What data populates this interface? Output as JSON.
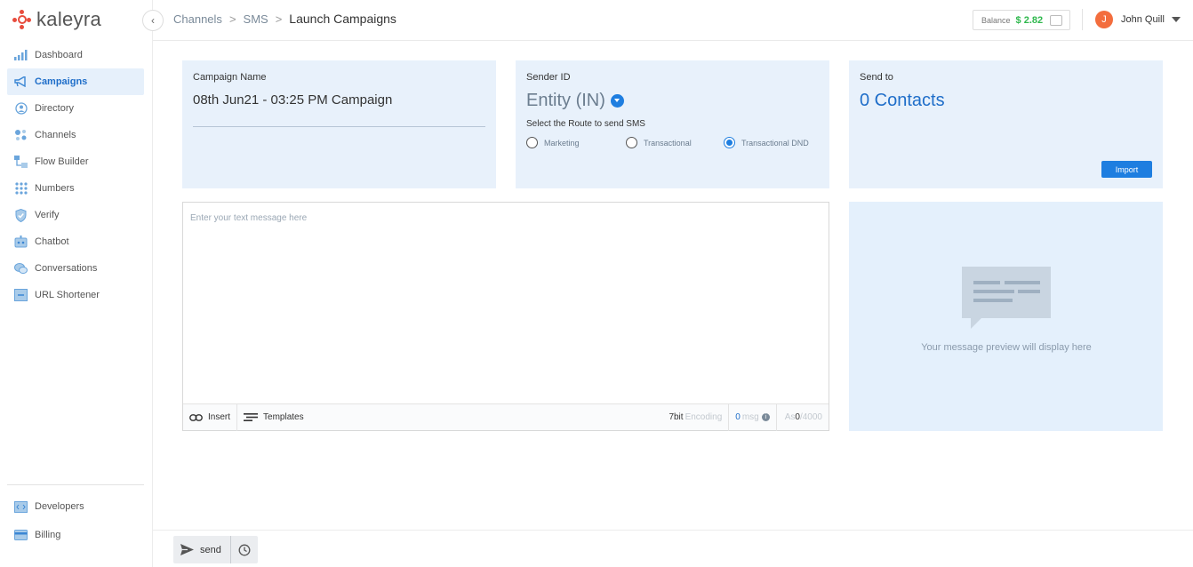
{
  "brand": {
    "name": "kaleyra",
    "color": "#e84c3d"
  },
  "sidebar": {
    "items": [
      {
        "label": "Dashboard",
        "icon": "bar-chart-icon",
        "active": false
      },
      {
        "label": "Campaigns",
        "icon": "megaphone-icon",
        "active": true
      },
      {
        "label": "Directory",
        "icon": "contact-circle-icon",
        "active": false
      },
      {
        "label": "Channels",
        "icon": "channels-icon",
        "active": false
      },
      {
        "label": "Flow Builder",
        "icon": "flow-icon",
        "active": false
      },
      {
        "label": "Numbers",
        "icon": "dial-pad-icon",
        "active": false
      },
      {
        "label": "Verify",
        "icon": "shield-check-icon",
        "active": false
      },
      {
        "label": "Chatbot",
        "icon": "robot-icon",
        "active": false
      },
      {
        "label": "Conversations",
        "icon": "chat-bubbles-icon",
        "active": false
      },
      {
        "label": "URL Shortener",
        "icon": "link-box-icon",
        "active": false
      }
    ],
    "bottom_items": [
      {
        "label": "Developers",
        "icon": "code-icon"
      },
      {
        "label": "Billing",
        "icon": "card-icon"
      }
    ]
  },
  "header": {
    "breadcrumb": [
      "Channels",
      "SMS",
      "Launch Campaigns"
    ],
    "balance_label": "Balance",
    "balance_amount": "$ 2.82",
    "user_initial": "J",
    "user_name": "John Quill"
  },
  "campaign": {
    "label": "Campaign Name",
    "value": "08th Jun21 - 03:25 PM Campaign"
  },
  "sender": {
    "label": "Sender ID",
    "value": "Entity (IN)",
    "route_label": "Select the Route to send SMS",
    "routes": [
      {
        "label": "Marketing",
        "checked": false
      },
      {
        "label": "Transactional",
        "checked": false
      },
      {
        "label": "Transactional DND",
        "checked": true
      }
    ]
  },
  "send_to": {
    "label": "Send to",
    "value": "0 Contacts",
    "import_label": "Import"
  },
  "message": {
    "placeholder": "Enter your text message here",
    "insert_label": "Insert",
    "templates_label": "Templates",
    "encoding_value": "7bit",
    "encoding_label": "Encoding",
    "msg_count": "0",
    "msg_label": "msg",
    "chars_prefix": "As ",
    "chars_used": "0",
    "chars_max": "/4000"
  },
  "preview": {
    "text": "Your message preview will display here"
  },
  "footer": {
    "send_label": "send"
  },
  "colors": {
    "accent": "#1e7ee0",
    "card_bg": "#e8f1fb",
    "balance_green": "#2fb84d",
    "avatar": "#f36d3d"
  }
}
